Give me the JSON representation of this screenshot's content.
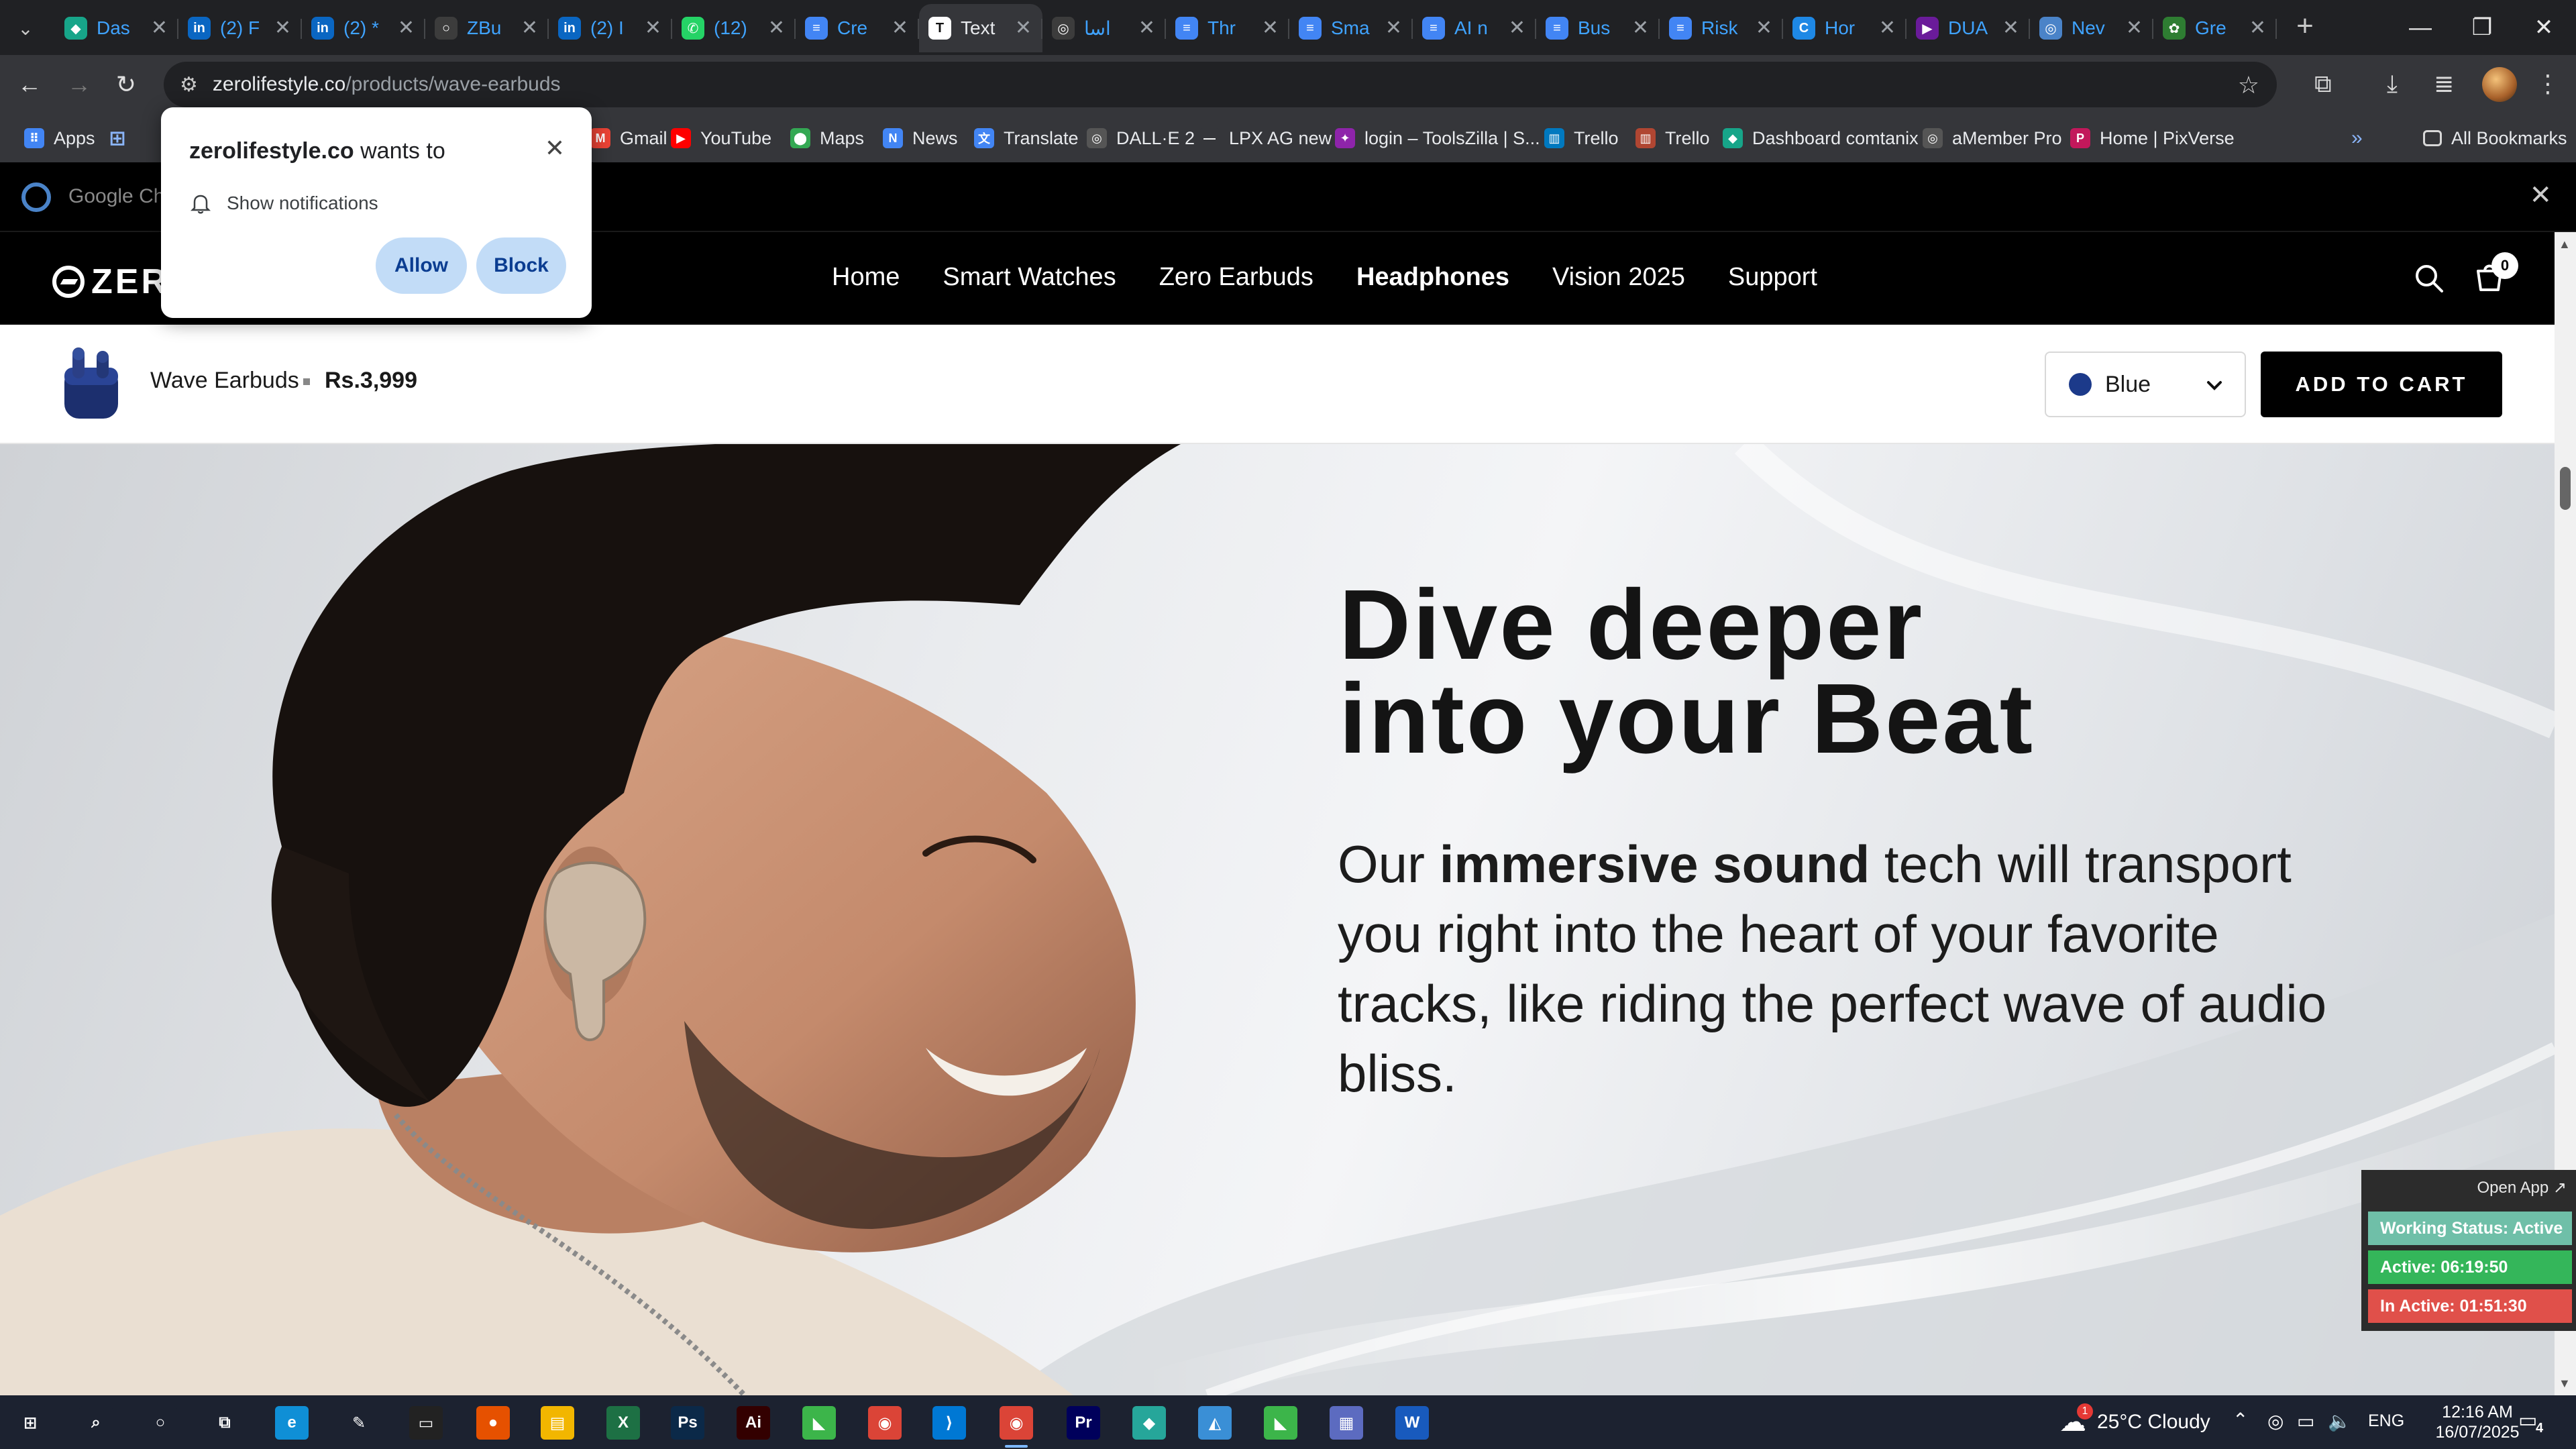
{
  "browser": {
    "tabs": [
      {
        "title": "Das",
        "favicon_color": "#17a589",
        "favicon_glyph": "◆"
      },
      {
        "title": "(2) F",
        "favicon_color": "#0a66c2",
        "favicon_glyph": "in"
      },
      {
        "title": "(2) *",
        "favicon_color": "#0a66c2",
        "favicon_glyph": "in"
      },
      {
        "title": "ZBu",
        "favicon_color": "#3c3c3c",
        "favicon_glyph": "○"
      },
      {
        "title": "(2) I",
        "favicon_color": "#0a66c2",
        "favicon_glyph": "in"
      },
      {
        "title": "(12)",
        "favicon_color": "#25d366",
        "favicon_glyph": "✆"
      },
      {
        "title": "Cre",
        "favicon_color": "#4285f4",
        "favicon_glyph": "≡"
      },
      {
        "title": "Text",
        "favicon_color": "#ffffff",
        "favicon_glyph": "T",
        "active": true
      },
      {
        "title": "اسا",
        "favicon_color": "#3c3c3c",
        "favicon_glyph": "◎"
      },
      {
        "title": "Thr",
        "favicon_color": "#4285f4",
        "favicon_glyph": "≡"
      },
      {
        "title": "Sma",
        "favicon_color": "#4285f4",
        "favicon_glyph": "≡"
      },
      {
        "title": "AI n",
        "favicon_color": "#4285f4",
        "favicon_glyph": "≡"
      },
      {
        "title": "Bus",
        "favicon_color": "#4285f4",
        "favicon_glyph": "≡"
      },
      {
        "title": "Risk",
        "favicon_color": "#4285f4",
        "favicon_glyph": "≡"
      },
      {
        "title": "Hor",
        "favicon_color": "#1e88e5",
        "favicon_glyph": "C"
      },
      {
        "title": "DUA",
        "favicon_color": "#6a1b9a",
        "favicon_glyph": "▶"
      },
      {
        "title": "Nev",
        "favicon_color": "#4a83c8",
        "favicon_glyph": "◎"
      },
      {
        "title": "Gre",
        "favicon_color": "#2e7d32",
        "favicon_glyph": "✿"
      }
    ],
    "url_host": "zerolifestyle.co",
    "url_path": "/products/wave-earbuds",
    "bookmarks": [
      {
        "label": "Apps",
        "color": "#4285f4",
        "glyph": "⠿"
      },
      {
        "label": "Gmail",
        "color": "#ea4335",
        "glyph": "M"
      },
      {
        "label": "YouTube",
        "color": "#ff0000",
        "glyph": "▶"
      },
      {
        "label": "Maps",
        "color": "#34a853",
        "glyph": "⬤"
      },
      {
        "label": "News",
        "color": "#4285f4",
        "glyph": "N"
      },
      {
        "label": "Translate",
        "color": "#4285f4",
        "glyph": "文"
      },
      {
        "label": "DALL·E 2",
        "color": "#555555",
        "glyph": "◎"
      },
      {
        "label": "LPX AG new",
        "color": "#35363a",
        "glyph": "—"
      },
      {
        "label": "login – ToolsZilla | S...",
        "color": "#8e24aa",
        "glyph": "✦"
      },
      {
        "label": "Trello",
        "color": "#0079bf",
        "glyph": "▥"
      },
      {
        "label": "Trello",
        "color": "#b04632",
        "glyph": "▥"
      },
      {
        "label": "Dashboard comtanix",
        "color": "#17a589",
        "glyph": "◆"
      },
      {
        "label": "aMember Pro",
        "color": "#555555",
        "glyph": "◎"
      },
      {
        "label": "Home | PixVerse",
        "color": "#c2185b",
        "glyph": "P"
      }
    ],
    "all_bookmarks": "All Bookmarks",
    "infobar_text": "Google Chr"
  },
  "notification": {
    "site": "zerolifestyle.co",
    "suffix": " wants to",
    "permission": "Show notifications",
    "allow": "Allow",
    "block": "Block"
  },
  "site": {
    "logo_text": "ZER",
    "nav": [
      "Home",
      "Smart Watches",
      "Zero Earbuds",
      "Headphones",
      "Vision 2025",
      "Support"
    ],
    "current_nav": "Headphones",
    "cart_count": "0"
  },
  "product_bar": {
    "name": "Wave Earbuds",
    "price": "Rs.3,999",
    "color": "Blue",
    "color_hex": "#1c3a8a",
    "add_to_cart": "ADD TO CART"
  },
  "hero": {
    "heading_line1": "Dive deeper",
    "heading_line2": "into your Beat",
    "body_pre": "Our ",
    "body_bold": "immersive sound",
    "body_post": " tech will transport you right into the heart of your favorite tracks, like riding the perfect wave of audio bliss."
  },
  "status_widget": {
    "open_app": "Open App ↗",
    "working": "Working Status: Active",
    "active": "Active: 06:19:50",
    "inactive": "In Active: 01:51:30",
    "colors": {
      "working": "#6fbfa8",
      "active": "#34b65a",
      "inactive": "#e0504a"
    }
  },
  "taskbar": {
    "weather": "25°C  Cloudy",
    "weather_badge": "1",
    "language": "ENG",
    "time": "12:16 AM",
    "date": "16/07/2025",
    "notif_count": "4",
    "apps": [
      {
        "name": "start",
        "glyph": "⊞",
        "color": "#1c2230"
      },
      {
        "name": "search",
        "glyph": "⌕",
        "color": "#1c2230"
      },
      {
        "name": "cortana",
        "glyph": "○",
        "color": "#1c2230"
      },
      {
        "name": "task-view",
        "glyph": "⧉",
        "color": "#1c2230"
      },
      {
        "name": "edge",
        "glyph": "e",
        "color": "#0f8fd6"
      },
      {
        "name": "pen",
        "glyph": "✎",
        "color": "#1c2230"
      },
      {
        "name": "terminal",
        "glyph": "▭",
        "color": "#222222"
      },
      {
        "name": "app-badge",
        "glyph": "●",
        "color": "#e65100"
      },
      {
        "name": "file-explorer",
        "glyph": "▤",
        "color": "#f2b600"
      },
      {
        "name": "excel",
        "glyph": "X",
        "color": "#1d7044"
      },
      {
        "name": "photoshop",
        "glyph": "Ps",
        "color": "#0b2948"
      },
      {
        "name": "illustrator",
        "glyph": "Ai",
        "color": "#330000"
      },
      {
        "name": "green-app",
        "glyph": "◣",
        "color": "#3cb54a"
      },
      {
        "name": "chrome",
        "glyph": "◉",
        "color": "#db4437"
      },
      {
        "name": "vscode",
        "glyph": "⟩",
        "color": "#0078d4"
      },
      {
        "name": "chrome-active",
        "glyph": "◉",
        "color": "#db4437"
      },
      {
        "name": "premiere",
        "glyph": "Pr",
        "color": "#00005b"
      },
      {
        "name": "teal-app",
        "glyph": "◆",
        "color": "#26a69a"
      },
      {
        "name": "blue-app",
        "glyph": "◭",
        "color": "#3a8fd6"
      },
      {
        "name": "green-app-2",
        "glyph": "◣",
        "color": "#3cb54a"
      },
      {
        "name": "calculator",
        "glyph": "▦",
        "color": "#5c6bc0"
      },
      {
        "name": "word",
        "glyph": "W",
        "color": "#185abd"
      }
    ]
  }
}
